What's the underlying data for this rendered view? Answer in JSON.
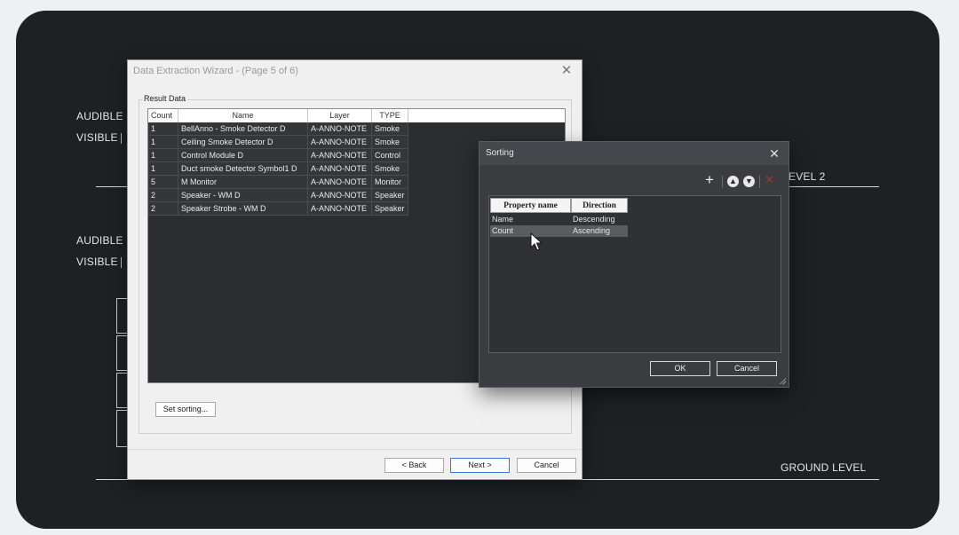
{
  "cad": {
    "labels": [
      {
        "text": "AUDIBLE"
      },
      {
        "text": "VISIBLE"
      },
      {
        "text": "AUDIBLE"
      },
      {
        "text": "VISIBLE"
      },
      {
        "text": "EVEL 2"
      },
      {
        "text": "GROUND LEVEL"
      }
    ]
  },
  "wizard": {
    "title": "Data Extraction Wizard - (Page 5 of 6)",
    "group_label": "Result Data",
    "columns": [
      "Count",
      "Name",
      "Layer",
      "TYPE"
    ],
    "rows": [
      [
        "1",
        "BellAnno - Smoke Detector D",
        "A-ANNO-NOTE",
        "Smoke"
      ],
      [
        "1",
        "Ceiling Smoke Detector D",
        "A-ANNO-NOTE",
        "Smoke"
      ],
      [
        "1",
        "Control Module D",
        "A-ANNO-NOTE",
        "Control"
      ],
      [
        "1",
        "Duct smoke Detector Symbol1 D",
        "A-ANNO-NOTE",
        "Smoke"
      ],
      [
        "5",
        "M Monitor",
        "A-ANNO-NOTE",
        "Monitor"
      ],
      [
        "2",
        "Speaker - WM  D",
        "A-ANNO-NOTE",
        "Speaker"
      ],
      [
        "2",
        "Speaker Strobe - WM D",
        "A-ANNO-NOTE",
        "Speaker"
      ]
    ],
    "set_sorting_label": "Set sorting...",
    "back_label": "< Back",
    "next_label": "Next >",
    "cancel_label": "Cancel"
  },
  "sorting": {
    "title": "Sorting",
    "columns": [
      "Property name",
      "Direction"
    ],
    "rows": [
      {
        "property": "Name",
        "direction": "Descending",
        "selected": false
      },
      {
        "property": "Count",
        "direction": "Ascending",
        "selected": true
      }
    ],
    "ok_label": "OK",
    "cancel_label": "Cancel",
    "toolbar_icons": [
      "plus-icon",
      "move-up-icon",
      "move-down-icon",
      "delete-icon"
    ]
  }
}
